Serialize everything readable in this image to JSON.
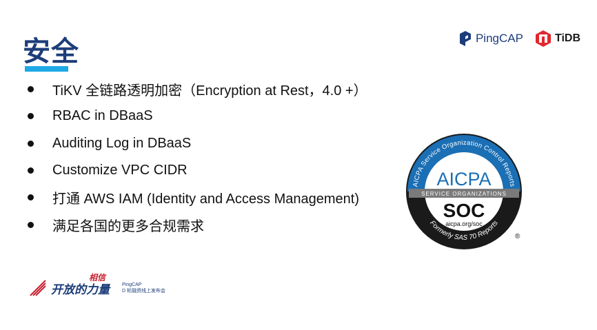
{
  "slide": {
    "title": "安全",
    "bullets": [
      "TiKV 全链路透明加密（Encryption at Rest，4.0 +）",
      "RBAC in DBaaS",
      "Auditing Log in DBaaS",
      "Customize VPC CIDR",
      "打通 AWS IAM (Identity and Access Management)",
      "满足各国的更多合规需求"
    ]
  },
  "logos": {
    "pingcap": "PingCAP",
    "tidb": "TiDB"
  },
  "badge": {
    "ring_text": "AICPA Service Organization Control Reports",
    "main": "AICPA",
    "band": "SERVICE ORGANIZATIONS",
    "soc": "SOC",
    "url": "aicpa.org/soc",
    "bottom_text": "Formerly SAS 70 Reports",
    "registered": "®"
  },
  "footer": {
    "main": "开放的力量",
    "badge_text": "相信",
    "line1": "PingCAP",
    "line2": "D 轮融资线上发布会"
  },
  "colors": {
    "title": "#1c3d7a",
    "accent_bar": "#1ea9e6",
    "badge_blue": "#1a6fb5",
    "footer_red": "#c8202e"
  }
}
